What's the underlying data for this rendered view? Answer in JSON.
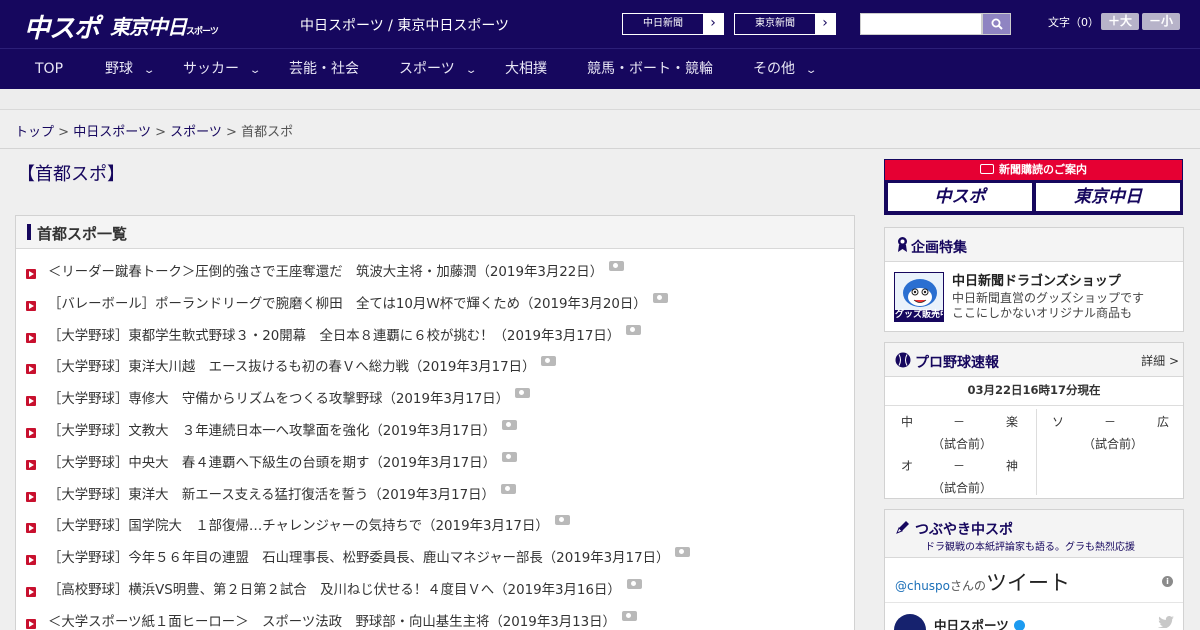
{
  "header": {
    "logo_chunichi": "中スポ",
    "logo_tokyo": "東京中日",
    "logo_tokyo_small": "スポーツ",
    "site_title": "中日スポーツ / 東京中日スポーツ",
    "ext_links": [
      {
        "label": "中日新聞"
      },
      {
        "label": "東京新聞"
      }
    ],
    "search_placeholder": "",
    "font_size_label": "文字（0）",
    "font_bigger": "＋大",
    "font_smaller": "－小"
  },
  "nav": [
    {
      "label": "TOP"
    },
    {
      "label": "野球",
      "dropdown": true
    },
    {
      "label": "サッカー",
      "dropdown": true
    },
    {
      "label": "芸能・社会"
    },
    {
      "label": "スポーツ",
      "dropdown": true
    },
    {
      "label": "大相撲"
    },
    {
      "label": "競馬・ボート・競輪"
    },
    {
      "label": "その他",
      "dropdown": true
    }
  ],
  "breadcrumb": {
    "items": [
      "トップ",
      "中日スポーツ",
      "スポーツ"
    ],
    "current": "首都スポ",
    "separator": ">"
  },
  "page_title": "【首都スポ】",
  "list_panel": {
    "title": "首都スポ一覧",
    "items": [
      "＜リーダー蹴春トーク＞圧倒的強さで王座奪還だ　筑波大主将・加藤潤（2019年3月22日）",
      "［バレーボール］ポーランドリーグで腕磨く柳田　全ては10月Ｗ杯で輝くため（2019年3月20日）",
      "［大学野球］東都学生軟式野球３・20開幕　全日本８連覇に６校が挑む！（2019年3月17日）",
      "［大学野球］東洋大川越　エース抜けるも初の春Ｖへ総力戦（2019年3月17日）",
      "［大学野球］専修大　守備からリズムをつくる攻撃野球（2019年3月17日）",
      "［大学野球］文教大　３年連続日本一へ攻撃面を強化（2019年3月17日）",
      "［大学野球］中央大　春４連覇へ下級生の台頭を期す（2019年3月17日）",
      "［大学野球］東洋大　新エース支える猛打復活を誓う（2019年3月17日）",
      "［大学野球］国学院大　１部復帰…チャレンジャーの気持ちで（2019年3月17日）",
      "［大学野球］今年５６年目の連盟　石山理事長、松野委員長、鹿山マネジャー部長（2019年3月17日）",
      "［高校野球］横浜VS明豊、第２日第２試合　及川ねじ伏せる！４度目Ｖへ（2019年3月16日）",
      "＜大学スポーツ紙１面ヒーロー＞　スポーツ法政　野球部・向山基生主将（2019年3月13日）"
    ]
  },
  "sidebar": {
    "ad": {
      "header": "新聞購読のご案内",
      "logo_left": "中スポ",
      "logo_right": "東京中日"
    },
    "special": {
      "title": "企画特集",
      "thumb_caption": "グッズ販売中",
      "item_title": "中日新聞ドラゴンズショップ",
      "item_desc_1": "中日新聞直営のグッズショップです",
      "item_desc_2": "ここにしかないオリジナル商品も"
    },
    "baseball": {
      "title": "プロ野球速報",
      "detail_link": "詳細 >",
      "timestamp": "03月22日16時17分現在",
      "games": [
        {
          "home": "中",
          "score": "－",
          "away": "楽",
          "status": "（試合前）"
        },
        {
          "home": "ソ",
          "score": "－",
          "away": "広",
          "status": "（試合前）"
        },
        {
          "home": "オ",
          "score": "－",
          "away": "神",
          "status": "（試合前）"
        }
      ]
    },
    "twitter": {
      "title": "つぶやき中スポ",
      "subtitle": "ドラ観戦の本紙評論家も語る。グラも熱烈応援",
      "handle": "@chuspo",
      "handle_suffix": "さんの",
      "tweets_label": "ツイート",
      "info": "i",
      "account_name": "中日スポーツ"
    }
  },
  "colors": {
    "brand_navy": "#16075e",
    "accent_red": "#e60033",
    "bullet_red": "#c8102e",
    "link": "#16075e"
  }
}
